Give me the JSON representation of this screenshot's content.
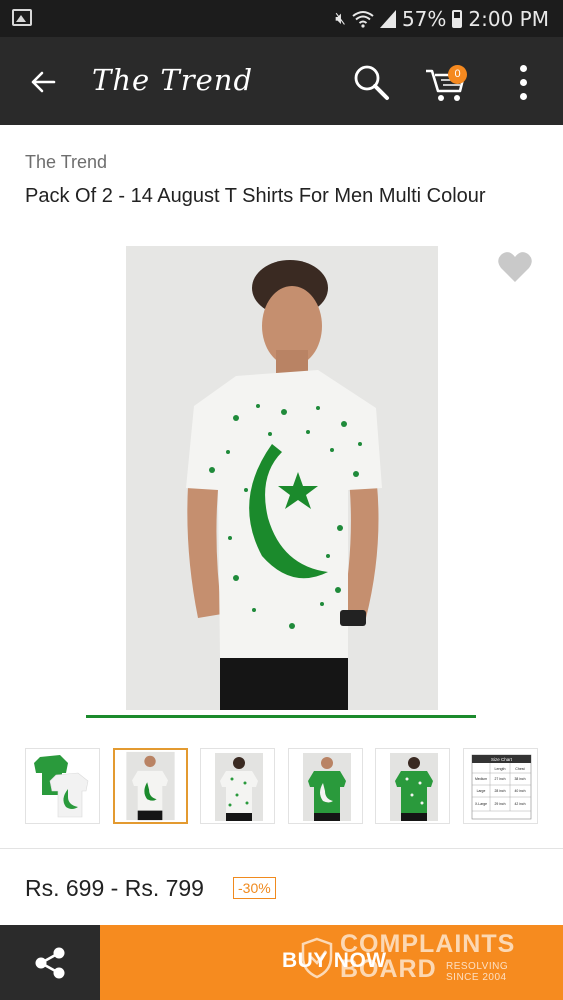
{
  "status_bar": {
    "battery": "57%",
    "time": "2:00 PM",
    "icons": [
      "photo-icon",
      "mute-icon",
      "wifi-icon",
      "signal-icon",
      "battery-icon"
    ]
  },
  "app_bar": {
    "title": "The Trend",
    "cart_count": "0",
    "icons": [
      "back-arrow-icon",
      "search-icon",
      "cart-icon",
      "more-vertical-icon"
    ]
  },
  "product": {
    "brand": "The Trend",
    "title": "Pack Of 2 - 14 August T Shirts For Men Multi Colour",
    "price": "Rs. 699 - Rs. 799",
    "discount": "-30%"
  },
  "gallery": {
    "selected_index": 1,
    "thumbnails": [
      {
        "name": "thumb-green-white-shirts"
      },
      {
        "name": "thumb-model-white-front"
      },
      {
        "name": "thumb-model-white-back"
      },
      {
        "name": "thumb-model-green-front"
      },
      {
        "name": "thumb-model-green-back"
      },
      {
        "name": "thumb-size-chart"
      }
    ],
    "size_chart": {
      "title": "Size Chart",
      "headers": [
        "",
        "Length",
        "Chest"
      ],
      "rows": [
        [
          "Medium",
          "27 inch",
          "38 inch"
        ],
        [
          "Large",
          "28 inch",
          "40 inch"
        ],
        [
          "X-Large",
          "29 inch",
          "42 inch"
        ]
      ]
    }
  },
  "bottom_bar": {
    "buy_label": "BUY NOW",
    "watermark": {
      "line1": "COMPLAINTS",
      "line2": "BOARD",
      "line3": "RESOLVING",
      "line4": "SINCE 2004"
    }
  },
  "colors": {
    "status_bar": "#1c1c1c",
    "app_bar": "#2a2a2a",
    "accent": "#f68b1f",
    "shirt_green": "#1b8a2c"
  }
}
